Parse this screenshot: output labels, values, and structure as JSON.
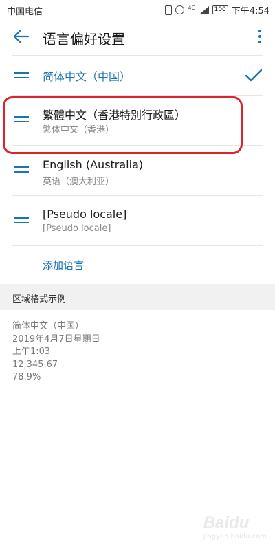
{
  "status_bar": {
    "carrier": "中国电信",
    "network": "4G",
    "battery": "100",
    "time": "下午4:54"
  },
  "app_bar": {
    "title": "语言偏好设置",
    "back_icon": "arrow-left-icon",
    "more_icon": "more-vertical-icon"
  },
  "languages": [
    {
      "name": "简体中文（中国）",
      "selected": true
    },
    {
      "name": "繁體中文（香港特別行政區）",
      "subtitle": "繁体中文（香港）"
    },
    {
      "name": "English (Australia)",
      "subtitle": "英语（澳大利亚）"
    },
    {
      "name": "[Pseudo locale]",
      "subtitle": "[Pseudo locale]"
    }
  ],
  "add_language_label": "添加语言",
  "region": {
    "header": "区域格式示例",
    "examples": [
      "简体中文（中国）",
      "2019年4月7日星期日",
      "上午1:03",
      "12,345.67",
      "78.9%"
    ]
  },
  "watermark": {
    "logo": "Baidu",
    "subtitle": "jingyan.baidu.com"
  },
  "colors": {
    "accent": "#1a73b5",
    "highlight_border": "#d9262c",
    "region_header_bg": "#f1f1f1"
  }
}
